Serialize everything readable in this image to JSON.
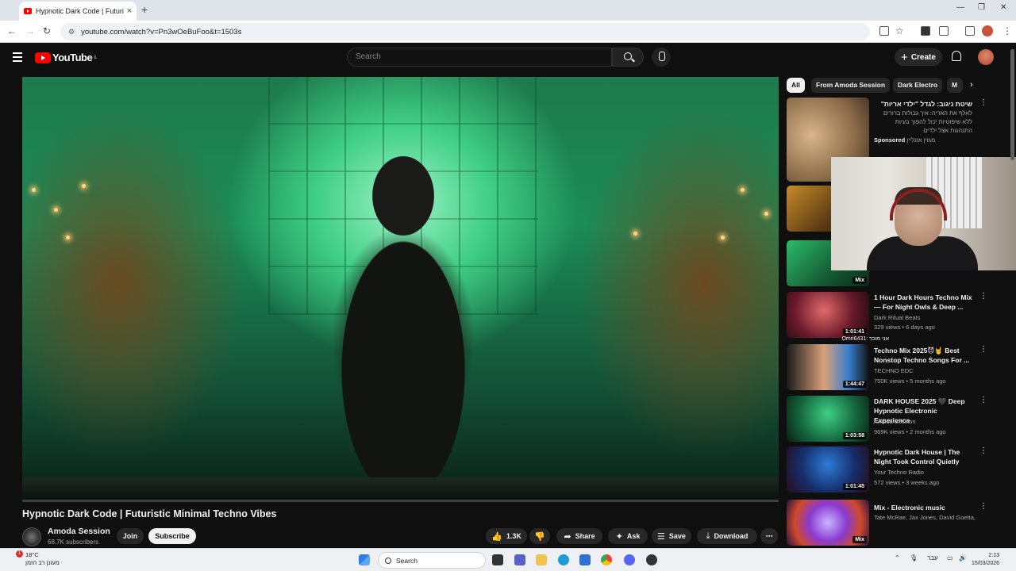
{
  "browser": {
    "tab_title": "Hypnotic Dark Code | Futuristic",
    "url": "youtube.com/watch?v=Pn3wOeBuFoo&t=1503s",
    "new_tab": "+",
    "tab_close": "×"
  },
  "header": {
    "logo_text": "YouTube",
    "logo_region": "IL",
    "search_placeholder": "Search",
    "create_label": "Create"
  },
  "video": {
    "title": "Hypnotic Dark Code | Futuristic Minimal Techno Vibes",
    "progress": 0.0
  },
  "owner": {
    "channel": "Amoda Session",
    "subscribers": "68.7K subscribers",
    "join_label": "Join",
    "subscribe_label": "Subscribe"
  },
  "actions": {
    "likes": "1.3K",
    "share": "Share",
    "ask": "Ask",
    "save": "Save",
    "download": "Download"
  },
  "chips": [
    "All",
    "From Amoda Session",
    "Dark Electro",
    "M"
  ],
  "ad": {
    "title": "שיטת ניגוב: לגדל \"ילדי אריות\"",
    "text": "לאלף את האריה: איך גבולות ברורים ללא שיפוטיות יכול להפוך בעיות התנהגות אצל ילדים",
    "sponsored": "Sponsored",
    "advertiser": "מגזין אונליין"
  },
  "recommendations": [
    {
      "title": "",
      "channel": "",
      "meta": "",
      "badge": ""
    },
    {
      "title": "",
      "channel": "",
      "meta": "",
      "badge": "Mix"
    },
    {
      "title": "1 Hour Dark Hours Techno Mix — For Night Owls & Deep ...",
      "channel": "Dark Ritual Beats",
      "meta": "329 views • 6 days ago",
      "badge": "1:01:41"
    },
    {
      "title": "Techno Mix 2025😈🤘 Best Nonstop Techno Songs For ...",
      "channel": "TECHNO EDC",
      "meta": "750K views • 5 months ago",
      "badge": "1:44:47"
    },
    {
      "title": "DARK HOUSE 2025 🖤 Deep Hypnotic Electronic Experience",
      "channel": "Amoda Session",
      "meta": "969K views • 2 months ago",
      "badge": "1:03:58"
    },
    {
      "title": "Hypnotic Dark House | The Night Took Control Quietly",
      "channel": "Your Techno Radio",
      "meta": "572 views • 3 weeks ago",
      "badge": "1:01:45"
    },
    {
      "title": "Mix - Electronic music",
      "channel": "Tate McRae, Jax Jones, David Guetta, an...",
      "meta": "",
      "badge": "Mix"
    }
  ],
  "overlay": {
    "line1": "אני מוכר :Omri6431",
    "line2": "Omri6431 : oo"
  },
  "taskbar": {
    "temp": "18°C",
    "weather": "מעונן רב הזמן",
    "notif": "1",
    "search": "Search",
    "lang": "עבר",
    "time": "2:13",
    "date": "15/03/2026"
  },
  "colors": {
    "accent": "#ff0000",
    "background": "#0f0f0f",
    "chip_active": "#f1f1f1"
  }
}
